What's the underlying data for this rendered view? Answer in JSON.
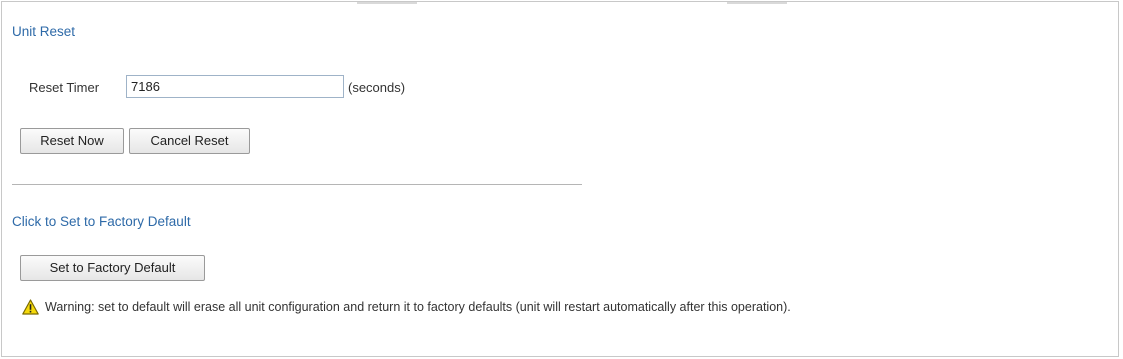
{
  "unit_reset": {
    "title": "Unit Reset",
    "timer_label": "Reset Timer",
    "timer_value": "7186",
    "timer_unit": "(seconds)",
    "reset_now_label": "Reset Now",
    "cancel_reset_label": "Cancel Reset"
  },
  "factory_default": {
    "title": "Click to Set to Factory Default",
    "button_label": "Set to Factory Default",
    "warning_icon": "warning-triangle-icon",
    "warning_text": "Warning: set to default will erase all unit configuration and return it to factory defaults (unit will restart automatically after this operation)."
  },
  "colors": {
    "section_title": "#2e6aa8",
    "warning_icon_fill": "#f5d90a",
    "warning_icon_stroke": "#7a6a00"
  }
}
